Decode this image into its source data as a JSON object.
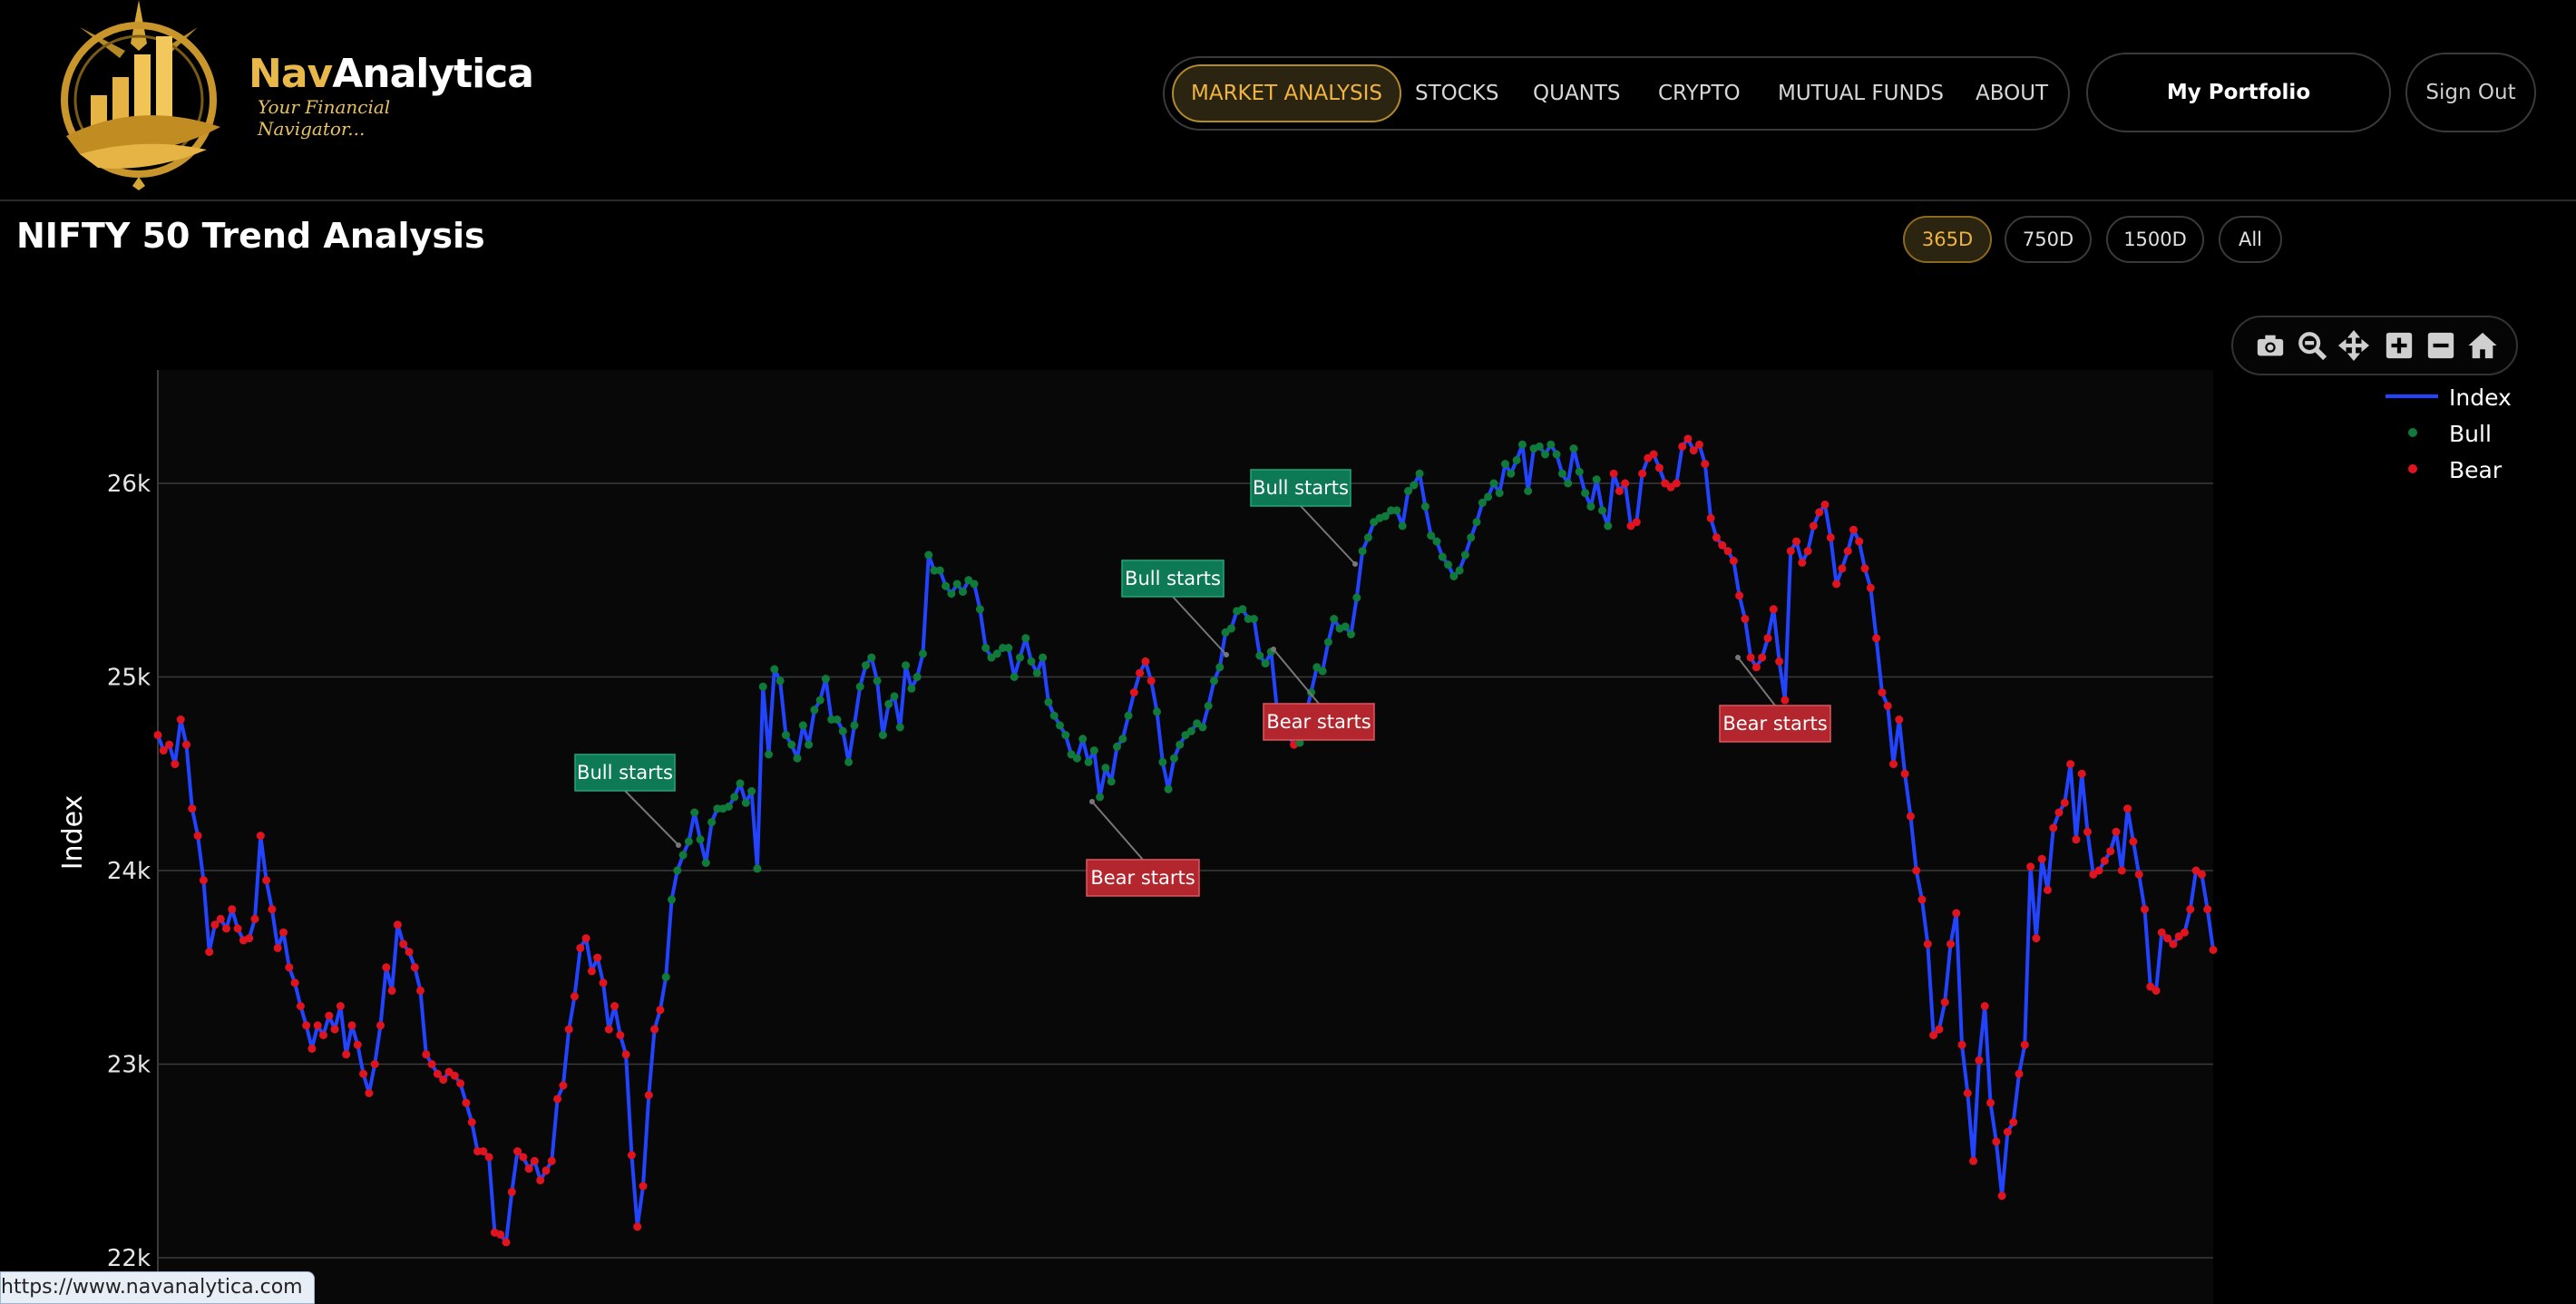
{
  "app": {
    "brand_part1": "Nav",
    "brand_part2": "Analytica",
    "tagline": "Your Financial Navigator...",
    "colors": {
      "gold": "#e8b84a",
      "accent": "#f0b440",
      "bull": "#0f7a3a",
      "bear": "#e0141e",
      "line": "#2244ff"
    }
  },
  "nav": {
    "items": [
      {
        "label": "MARKET ANALYSIS",
        "active": true
      },
      {
        "label": "STOCKS",
        "active": false
      },
      {
        "label": "QUANTS",
        "active": false
      },
      {
        "label": "CRYPTO",
        "active": false
      },
      {
        "label": "MUTUAL FUNDS",
        "active": false
      },
      {
        "label": "ABOUT",
        "active": false
      }
    ],
    "portfolio": "My Portfolio",
    "signout": "Sign Out"
  },
  "page": {
    "title": "NIFTY 50 Trend Analysis",
    "ranges": [
      {
        "label": "365D",
        "active": true
      },
      {
        "label": "750D",
        "active": false
      },
      {
        "label": "1500D",
        "active": false
      },
      {
        "label": "All",
        "active": false
      }
    ]
  },
  "toolbar": {
    "icons": [
      "camera-icon",
      "zoom-icon",
      "pan-icon",
      "zoom-in-icon",
      "zoom-out-icon",
      "home-icon"
    ]
  },
  "status_url": "https://www.navanalytica.com",
  "chart_data": {
    "type": "line",
    "ylabel": "Index",
    "yticks": [
      "22k",
      "23k",
      "24k",
      "25k",
      "26k"
    ],
    "ytick_values": [
      22000,
      23000,
      24000,
      25000,
      26000
    ],
    "ylim": [
      21800,
      26600
    ],
    "grid": true,
    "legend": {
      "placement": "top-right",
      "entries": [
        "Index",
        "Bull",
        "Bear"
      ]
    },
    "index_values": [
      24700,
      24620,
      24650,
      24550,
      24780,
      24650,
      24320,
      24180,
      23950,
      23580,
      23720,
      23750,
      23700,
      23800,
      23700,
      23640,
      23650,
      23750,
      24180,
      23950,
      23800,
      23600,
      23680,
      23500,
      23420,
      23300,
      23200,
      23080,
      23200,
      23150,
      23250,
      23180,
      23300,
      23050,
      23200,
      23100,
      22950,
      22850,
      23000,
      23200,
      23500,
      23380,
      23720,
      23620,
      23580,
      23500,
      23380,
      23050,
      23000,
      22950,
      22920,
      22960,
      22940,
      22900,
      22800,
      22700,
      22550,
      22550,
      22520,
      22130,
      22120,
      22080,
      22340,
      22550,
      22520,
      22460,
      22500,
      22400,
      22450,
      22500,
      22820,
      22890,
      23180,
      23350,
      23600,
      23650,
      23480,
      23550,
      23420,
      23180,
      23300,
      23150,
      23050,
      22530,
      22160,
      22370,
      22840,
      23180,
      23280,
      23450,
      23850,
      24000,
      24080,
      24150,
      24300,
      24160,
      24040,
      24250,
      24320,
      24320,
      24330,
      24380,
      24450,
      24350,
      24410,
      24010,
      24950,
      24600,
      25040,
      24980,
      24700,
      24650,
      24580,
      24750,
      24650,
      24830,
      24880,
      24990,
      24780,
      24780,
      24720,
      24560,
      24750,
      24950,
      25060,
      25100,
      24980,
      24700,
      24860,
      24900,
      24740,
      25060,
      24940,
      25000,
      25120,
      25630,
      25550,
      25550,
      25470,
      25430,
      25480,
      25440,
      25500,
      25480,
      25350,
      25150,
      25100,
      25120,
      25150,
      25150,
      25000,
      25100,
      25200,
      25080,
      25020,
      25100,
      24870,
      24800,
      24750,
      24700,
      24600,
      24580,
      24680,
      24560,
      24620,
      24380,
      24530,
      24460,
      24640,
      24680,
      24800,
      24920,
      25020,
      25080,
      24980,
      24820,
      24560,
      24420,
      24580,
      24650,
      24700,
      24720,
      24760,
      24740,
      24850,
      24980,
      25050,
      25230,
      25250,
      25340,
      25350,
      25300,
      25300,
      25110,
      25070,
      25130,
      24840,
      24750,
      24700,
      24650,
      24660,
      24800,
      24920,
      25050,
      25030,
      25180,
      25300,
      25250,
      25260,
      25220,
      25410,
      25650,
      25720,
      25800,
      25820,
      25830,
      25860,
      25860,
      25780,
      25960,
      25990,
      26050,
      25880,
      25730,
      25700,
      25620,
      25580,
      25520,
      25550,
      25630,
      25720,
      25800,
      25900,
      25930,
      26000,
      25950,
      26100,
      26050,
      26120,
      26200,
      25960,
      26180,
      26190,
      26150,
      26200,
      26150,
      26050,
      26000,
      26180,
      26060,
      25950,
      25880,
      26020,
      25860,
      25780,
      26050,
      25960,
      26000,
      25780,
      25800,
      26050,
      26130,
      26150,
      26080,
      26000,
      25980,
      26000,
      26190,
      26230,
      26170,
      26200,
      26100,
      25820,
      25720,
      25680,
      25650,
      25600,
      25420,
      25300,
      25100,
      25050,
      25100,
      25200,
      25350,
      25080,
      24880,
      25650,
      25700,
      25590,
      25650,
      25780,
      25850,
      25890,
      25720,
      25480,
      25560,
      25650,
      25760,
      25700,
      25560,
      25460,
      25200,
      24920,
      24850,
      24550,
      24780,
      24500,
      24280,
      24000,
      23850,
      23620,
      23150,
      23180,
      23320,
      23620,
      23780,
      23100,
      22850,
      22500,
      23020,
      23300,
      22800,
      22600,
      22320,
      22650,
      22700,
      22950,
      23100,
      24020,
      23650,
      24060,
      23900,
      24220,
      24300,
      24350,
      24550,
      24160,
      24500,
      24200,
      23980,
      24000,
      24050,
      24100,
      24200,
      24000,
      24320,
      24150,
      23980,
      23800,
      23400,
      23380,
      23680,
      23650,
      23620,
      23660,
      23680,
      23800,
      24000,
      23980,
      23800,
      23590
    ],
    "annotations": [
      {
        "text": "Bull starts",
        "type": "bull"
      },
      {
        "text": "Bear starts",
        "type": "bear"
      },
      {
        "text": "Bull starts",
        "type": "bull"
      },
      {
        "text": "Bear starts",
        "type": "bear"
      },
      {
        "text": "Bull starts",
        "type": "bull"
      },
      {
        "text": "Bear starts",
        "type": "bear"
      }
    ],
    "bull_segments": [
      [
        89,
        134
      ],
      [
        135,
        170
      ],
      [
        175,
        196
      ],
      [
        200,
        254
      ]
    ]
  }
}
